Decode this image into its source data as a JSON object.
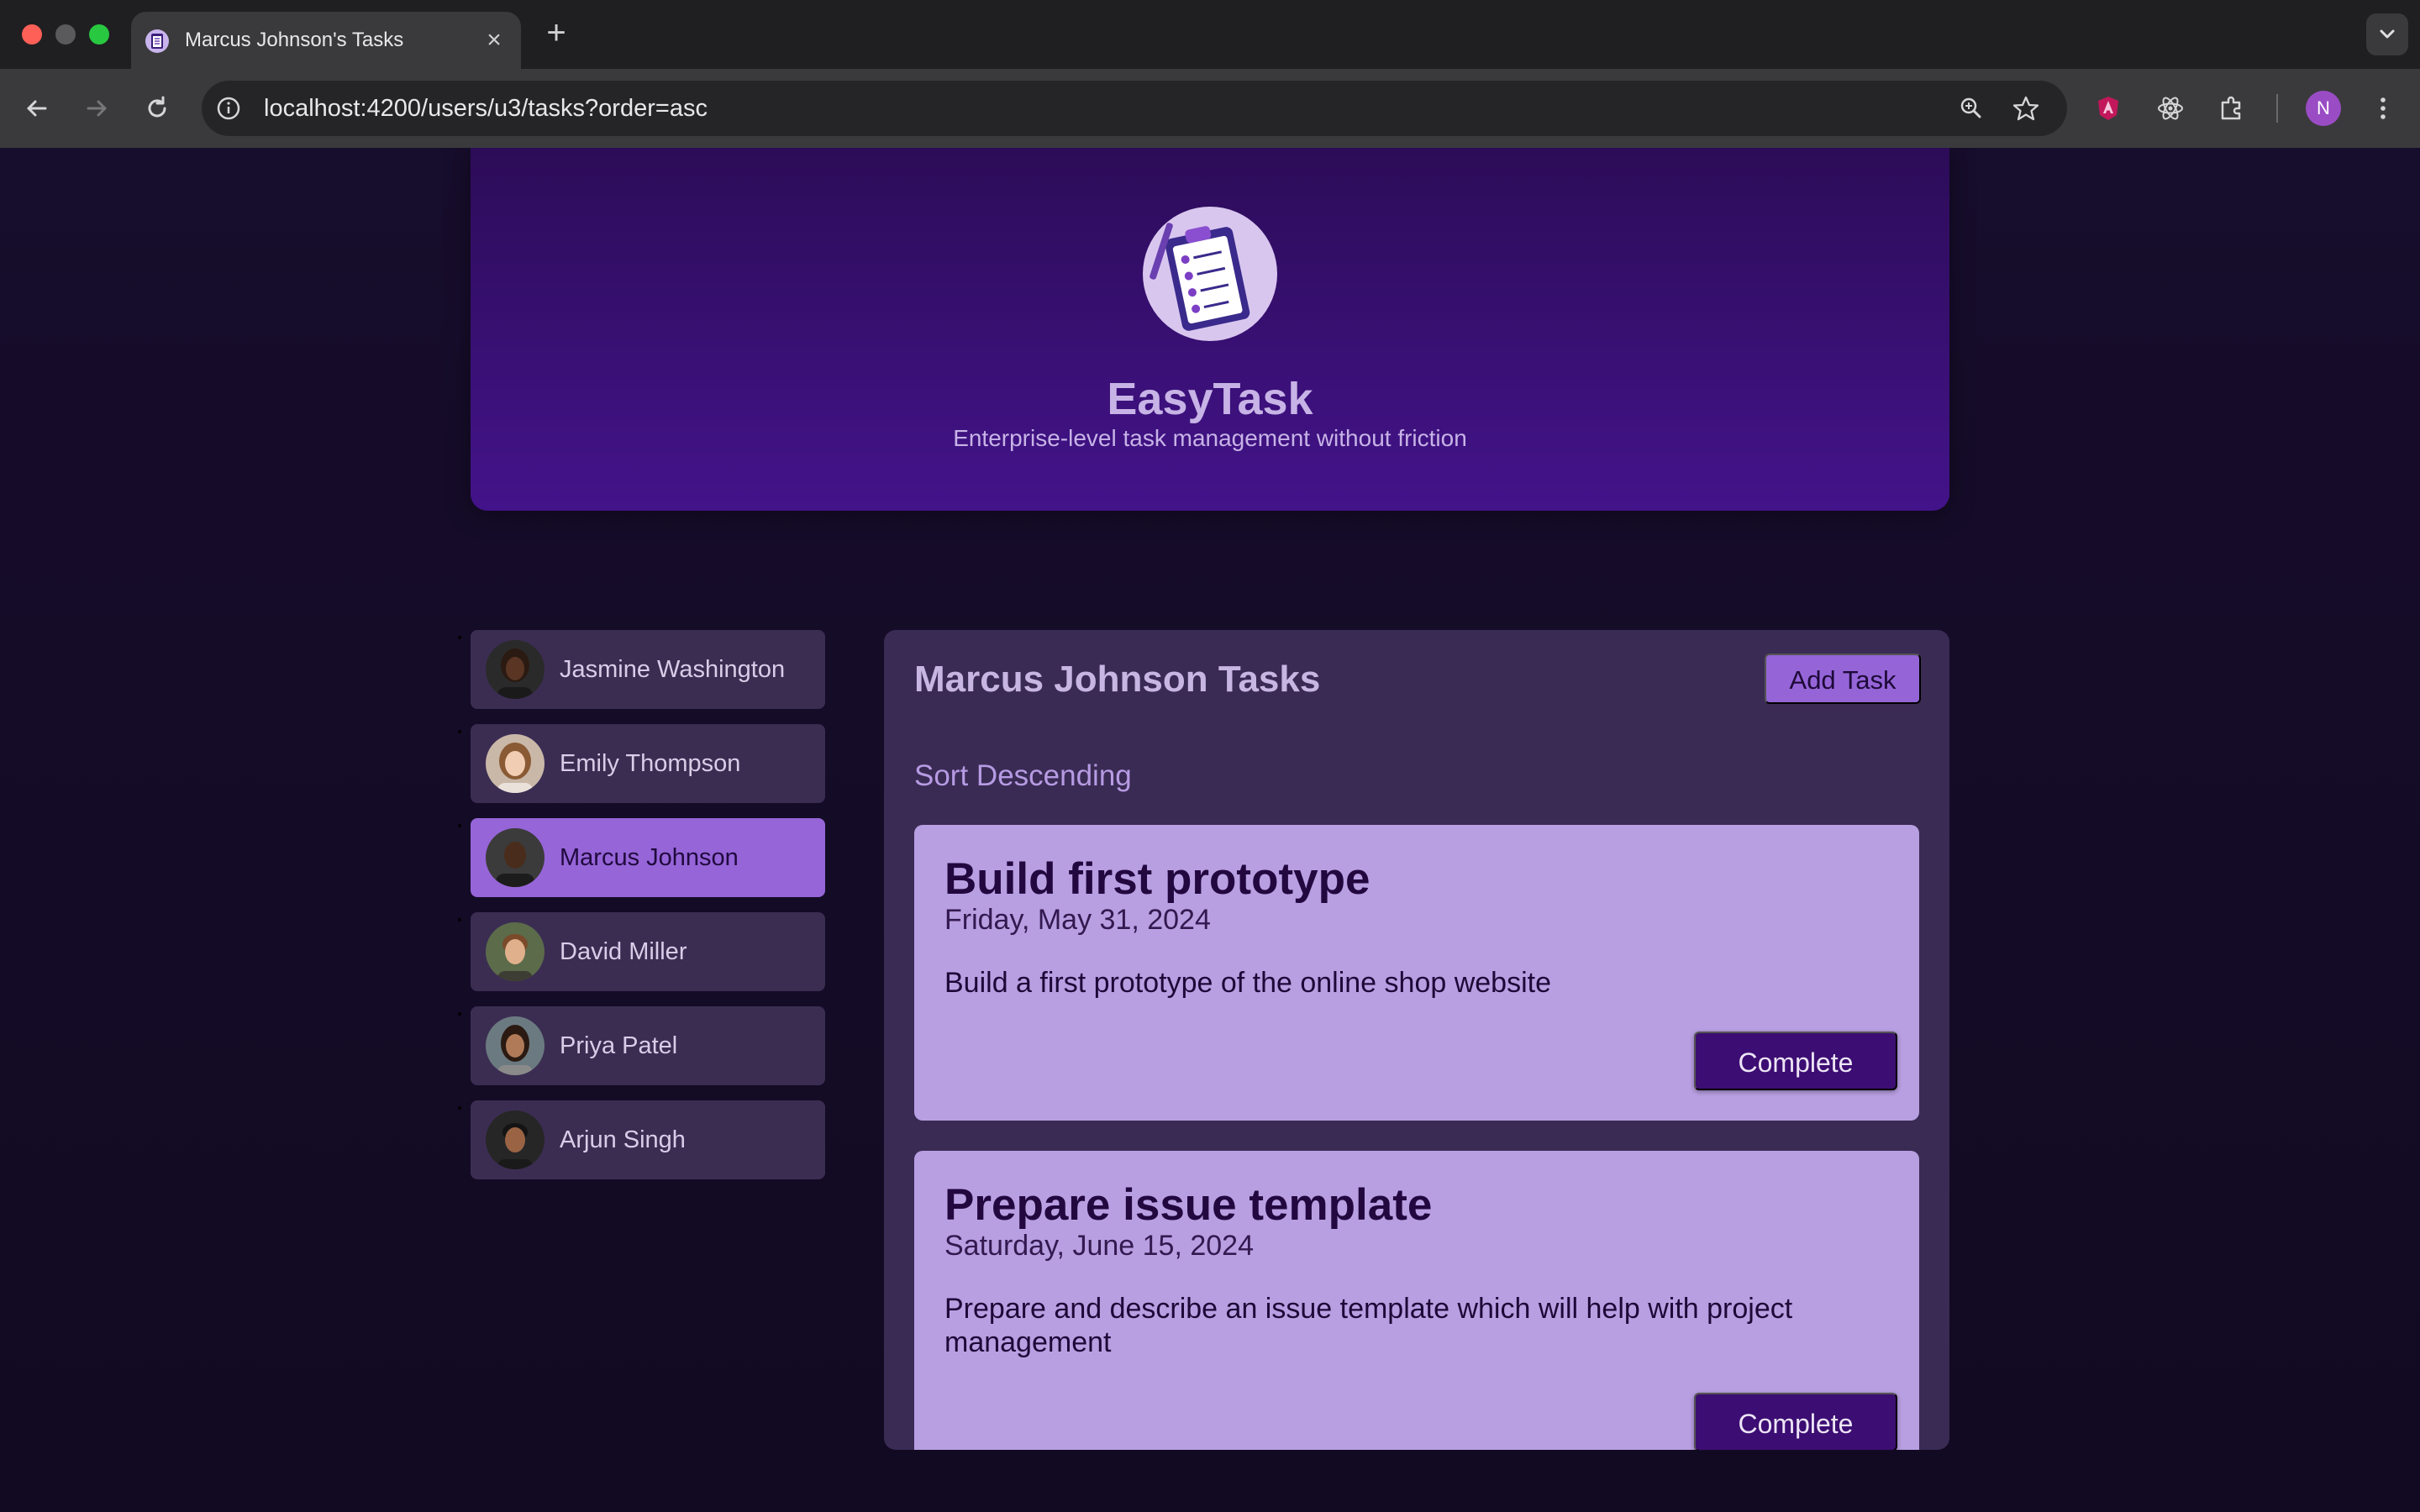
{
  "browser": {
    "tab_title": "Marcus Johnson's Tasks",
    "url": "localhost:4200/users/u3/tasks?order=asc",
    "profile_initial": "N",
    "icons": [
      "close-icon",
      "plus-icon",
      "chevron-down-icon",
      "back-arrow-icon",
      "forward-arrow-icon",
      "reload-icon",
      "info-icon",
      "zoom-icon",
      "star-icon",
      "angular-devtools-icon",
      "react-devtools-icon",
      "extensions-puzzle-icon",
      "kebab-menu-icon"
    ]
  },
  "header": {
    "title": "EasyTask",
    "subtitle": "Enterprise-level task management without friction"
  },
  "users": [
    {
      "name": "Jasmine Washington",
      "selected": false
    },
    {
      "name": "Emily Thompson",
      "selected": false
    },
    {
      "name": "Marcus Johnson",
      "selected": true
    },
    {
      "name": "David Miller",
      "selected": false
    },
    {
      "name": "Priya Patel",
      "selected": false
    },
    {
      "name": "Arjun Singh",
      "selected": false
    }
  ],
  "tasks_panel": {
    "title": "Marcus Johnson Tasks",
    "add_button": "Add Task",
    "sort_link": "Sort Descending",
    "tasks": [
      {
        "title": "Build first prototype",
        "date": "Friday, May 31, 2024",
        "description": "Build a first prototype of the online shop website",
        "button": "Complete"
      },
      {
        "title": "Prepare issue template",
        "date": "Saturday, June 15, 2024",
        "description": "Prepare and describe an issue template which will help with project management",
        "button": "Complete"
      }
    ]
  },
  "colors": {
    "header_gradient_top": "#2c0c58",
    "header_gradient_bottom": "#43138a",
    "accent": "#9565d8",
    "card": "#b89fe2",
    "complete_button": "#3c0d72"
  }
}
